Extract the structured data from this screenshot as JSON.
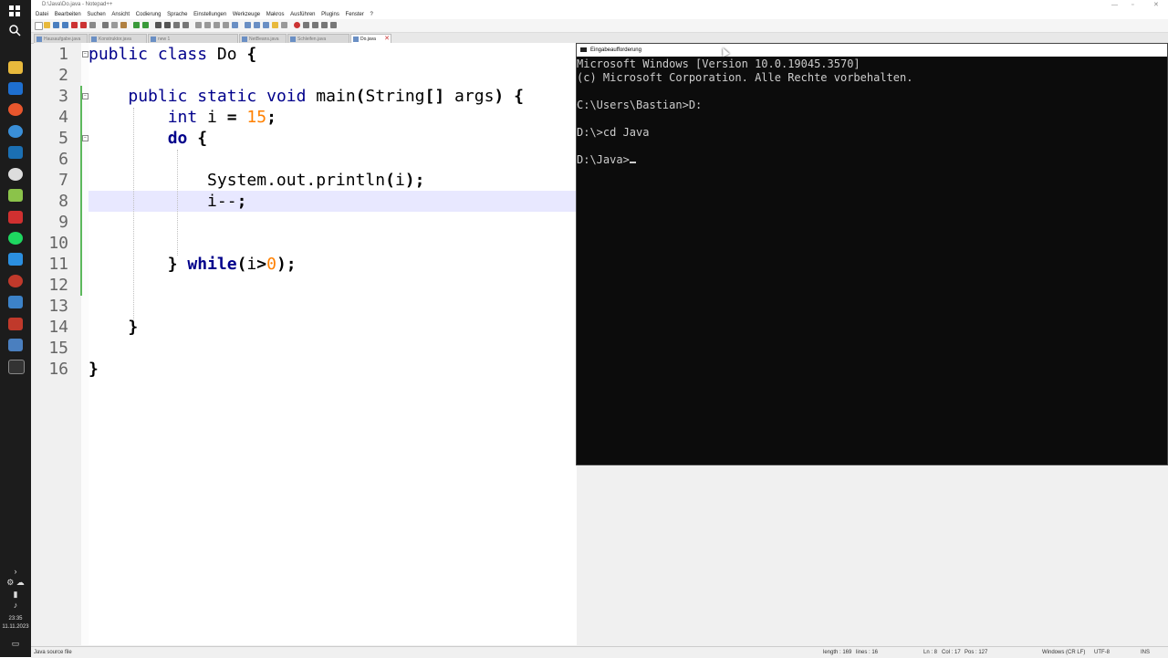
{
  "notepad": {
    "title": "D:\\Java\\Do.java - Notepad++",
    "menu": [
      "Datei",
      "Bearbeiten",
      "Suchen",
      "Ansicht",
      "Codierung",
      "Sprache",
      "Einstellungen",
      "Werkzeuge",
      "Makros",
      "Ausführen",
      "Plugins",
      "Fenster",
      "?"
    ],
    "tabs": [
      {
        "label": "Hausaufgabe.java",
        "active": false
      },
      {
        "label": "Konstruktor.java",
        "active": false
      },
      {
        "label": "new 1",
        "active": false
      },
      {
        "label": "NetBeans.java",
        "active": false
      },
      {
        "label": "Schleifen.java",
        "active": false
      },
      {
        "label": "Do.java",
        "active": true
      }
    ],
    "status": {
      "file_type": "Java source file",
      "length": "length : 169",
      "lines": "lines : 16",
      "ln": "Ln : 8",
      "col": "Col : 17",
      "pos": "Pos : 127",
      "eol": "Windows (CR LF)",
      "encoding": "UTF-8",
      "mode": "INS"
    }
  },
  "code_lines": [
    {
      "n": "1",
      "t": "public class Do {"
    },
    {
      "n": "2",
      "t": ""
    },
    {
      "n": "3",
      "t": "    public static void main(String[] args) {"
    },
    {
      "n": "4",
      "t": "        int i = 15;"
    },
    {
      "n": "5",
      "t": "        do {"
    },
    {
      "n": "6",
      "t": ""
    },
    {
      "n": "7",
      "t": "            System.out.println(i);"
    },
    {
      "n": "8",
      "t": "            i--;"
    },
    {
      "n": "9",
      "t": ""
    },
    {
      "n": "10",
      "t": ""
    },
    {
      "n": "11",
      "t": "        } while(i>0);"
    },
    {
      "n": "12",
      "t": ""
    },
    {
      "n": "13",
      "t": ""
    },
    {
      "n": "14",
      "t": "    }"
    },
    {
      "n": "15",
      "t": ""
    },
    {
      "n": "16",
      "t": "}"
    }
  ],
  "console": {
    "title": "Eingabeaufforderung",
    "lines": [
      "Microsoft Windows [Version 10.0.19045.3570]",
      "(c) Microsoft Corporation. Alle Rechte vorbehalten.",
      "",
      "C:\\Users\\Bastian>D:",
      "",
      "D:\\>cd Java",
      "",
      "D:\\Java>"
    ]
  },
  "taskbar": {
    "clock_time": "23:35",
    "clock_date": "11.11.2023",
    "icons": [
      "windows-start-icon",
      "search-icon",
      "file-explorer-icon",
      "mail-icon",
      "firefox-icon",
      "browser-icon",
      "steam-icon",
      "vpn-icon",
      "notepadpp-icon",
      "tool-icon",
      "spotify-icon",
      "vscode-icon",
      "app-icon",
      "sharkfin-icon",
      "filezilla-icon",
      "virtualbox-icon",
      "terminal-icon"
    ]
  }
}
